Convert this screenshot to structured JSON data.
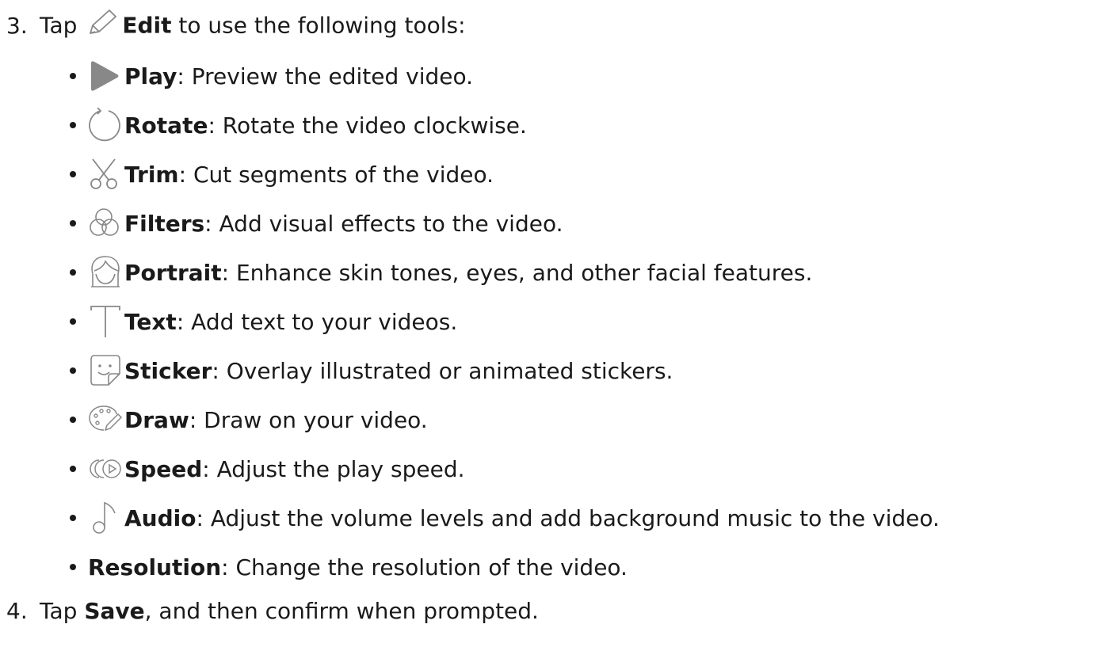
{
  "step3": {
    "number": "3.",
    "prefix": "Tap",
    "edit_label": "Edit",
    "suffix": "to use the following tools:"
  },
  "tools": [
    {
      "icon": "play-icon",
      "term": "Play",
      "desc": ": Preview the edited video."
    },
    {
      "icon": "rotate-icon",
      "term": "Rotate",
      "desc": ": Rotate the video clockwise."
    },
    {
      "icon": "scissors-icon",
      "term": "Trim",
      "desc": ": Cut segments of the video."
    },
    {
      "icon": "filters-icon",
      "term": "Filters",
      "desc": ": Add visual effects to the video."
    },
    {
      "icon": "portrait-icon",
      "term": "Portrait",
      "desc": ": Enhance skin tones, eyes, and other facial features."
    },
    {
      "icon": "text-icon",
      "term": "Text",
      "desc": ": Add text to your videos."
    },
    {
      "icon": "sticker-icon",
      "term": "Sticker",
      "desc": ": Overlay illustrated or animated stickers."
    },
    {
      "icon": "draw-icon",
      "term": "Draw",
      "desc": ": Draw on your video."
    },
    {
      "icon": "speed-icon",
      "term": "Speed",
      "desc": ": Adjust the play speed."
    },
    {
      "icon": "audio-icon",
      "term": "Audio",
      "desc": ": Adjust the volume levels and add background music to the video."
    },
    {
      "icon": "",
      "term": "Resolution",
      "desc": ": Change the resolution of the video."
    }
  ],
  "step4": {
    "number": "4.",
    "prefix": "Tap",
    "save_label": "Save",
    "suffix": ", and then confirm when prompted."
  },
  "colors": {
    "text": "#1a1a1a",
    "icon": "#888888"
  }
}
